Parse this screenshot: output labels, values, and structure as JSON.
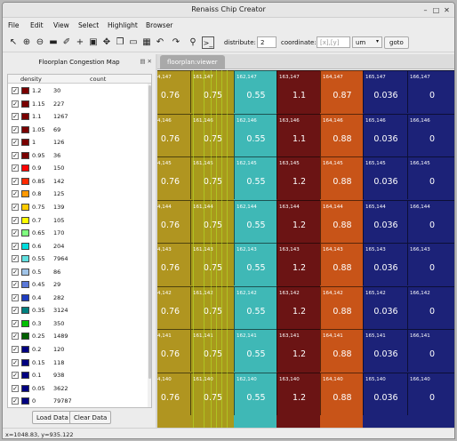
{
  "window": {
    "title": "Renaiss Chip Creator"
  },
  "menu": [
    "File",
    "Edit",
    "View",
    "Select",
    "Highlight",
    "Browser"
  ],
  "toolbar": {
    "distribute_label": "distribute:",
    "distribute_value": "2",
    "coordinate_label": "coordinate:",
    "coordinate_placeholder": "[x],[y]",
    "unit_value": "um",
    "goto_label": "goto"
  },
  "sidebar": {
    "title": "Floorplan Congestion Map",
    "headers": {
      "density": "density",
      "count": "count"
    },
    "rows": [
      {
        "density": "1.2",
        "count": "30",
        "color": "#7a0000"
      },
      {
        "density": "1.15",
        "count": "227",
        "color": "#7a0000"
      },
      {
        "density": "1.1",
        "count": "1267",
        "color": "#7a0000"
      },
      {
        "density": "1.05",
        "count": "69",
        "color": "#7a0000"
      },
      {
        "density": "1",
        "count": "126",
        "color": "#7a0000"
      },
      {
        "density": "0.95",
        "count": "36",
        "color": "#7a0000"
      },
      {
        "density": "0.9",
        "count": "150",
        "color": "#ff0000"
      },
      {
        "density": "0.85",
        "count": "142",
        "color": "#ff2a00"
      },
      {
        "density": "0.8",
        "count": "125",
        "color": "#ff9900"
      },
      {
        "density": "0.75",
        "count": "139",
        "color": "#ffcc00"
      },
      {
        "density": "0.7",
        "count": "105",
        "color": "#ffff00"
      },
      {
        "density": "0.65",
        "count": "170",
        "color": "#80ff80"
      },
      {
        "density": "0.6",
        "count": "204",
        "color": "#00dddd"
      },
      {
        "density": "0.55",
        "count": "7964",
        "color": "#60e0e0"
      },
      {
        "density": "0.5",
        "count": "86",
        "color": "#a0c4e8"
      },
      {
        "density": "0.45",
        "count": "29",
        "color": "#5a78d8"
      },
      {
        "density": "0.4",
        "count": "282",
        "color": "#1e3cc0"
      },
      {
        "density": "0.35",
        "count": "3124",
        "color": "#008080"
      },
      {
        "density": "0.3",
        "count": "350",
        "color": "#00c000"
      },
      {
        "density": "0.25",
        "count": "1489",
        "color": "#006000"
      },
      {
        "density": "0.2",
        "count": "120",
        "color": "#000080"
      },
      {
        "density": "0.15",
        "count": "118",
        "color": "#000080"
      },
      {
        "density": "0.1",
        "count": "938",
        "color": "#000080"
      },
      {
        "density": "0.05",
        "count": "3622",
        "color": "#000080"
      },
      {
        "density": "0",
        "count": "79787",
        "color": "#000080"
      }
    ],
    "load_label": "Load Data",
    "clear_label": "Clear Data"
  },
  "viewer": {
    "tab_label": "floorplan:viewer",
    "columns": [
      {
        "id": "164",
        "color": "#b09520",
        "values": [
          "0.76",
          "0.76",
          "0.76",
          "0.76",
          "0.76",
          "0.76",
          "0.76",
          "0.76"
        ],
        "labels": [
          "164,147",
          "164,146",
          "164,145",
          "164,144",
          "164,143",
          "164,142",
          "164,141",
          "164,140"
        ]
      },
      {
        "id": "161",
        "color": "#a89a1c",
        "values": [
          "0.75",
          "0.75",
          "0.75",
          "0.75",
          "0.75",
          "0.75",
          "0.75",
          "0.75"
        ],
        "labels": [
          "161,147",
          "161,146",
          "161,145",
          "161,144",
          "161,143",
          "161,142",
          "161,141",
          "161,140"
        ]
      },
      {
        "id": "162",
        "color": "#3fb8b6",
        "values": [
          "0.55",
          "0.55",
          "0.55",
          "0.55",
          "0.55",
          "0.55",
          "0.55",
          "0.55"
        ],
        "labels": [
          "162,147",
          "162,146",
          "162,145",
          "162,144",
          "162,143",
          "162,142",
          "162,141",
          "162,140"
        ]
      },
      {
        "id": "163",
        "color": "#6b1414",
        "values": [
          "1.1",
          "1.1",
          "1.2",
          "1.2",
          "1.2",
          "1.2",
          "1.2",
          "1.2"
        ],
        "labels": [
          "163,147",
          "163,146",
          "163,145",
          "163,144",
          "163,143",
          "163,142",
          "163,141",
          "163,140"
        ]
      },
      {
        "id": "164b",
        "color": "#c85418",
        "values": [
          "0.87",
          "0.88",
          "0.88",
          "0.88",
          "0.88",
          "0.88",
          "0.88",
          "0.88"
        ],
        "labels": [
          "164,147",
          "164,146",
          "164,145",
          "164,144",
          "164,143",
          "164,142",
          "164,141",
          "164,140"
        ]
      },
      {
        "id": "165",
        "color": "#1c2278",
        "values": [
          "0.036",
          "0.036",
          "0.036",
          "0.036",
          "0.036",
          "0.036",
          "0.036",
          "0.036"
        ],
        "labels": [
          "165,147",
          "165,146",
          "165,145",
          "165,144",
          "165,143",
          "165,142",
          "165,141",
          "165,140"
        ]
      },
      {
        "id": "166",
        "color": "#1c2278",
        "values": [
          "0",
          "0",
          "0",
          "0",
          "0",
          "0",
          "0",
          "0"
        ],
        "labels": [
          "166,147",
          "166,146",
          "166,145",
          "166,144",
          "166,143",
          "166,142",
          "166,141",
          "166,140"
        ]
      }
    ]
  },
  "status": {
    "text": "x=1048.83, y=935.122"
  }
}
